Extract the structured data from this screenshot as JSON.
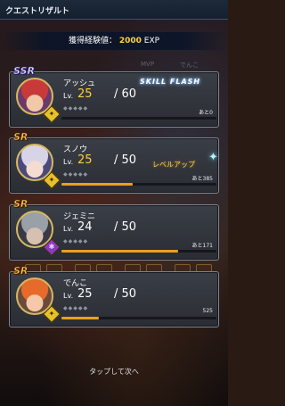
{
  "header": {
    "title": "クエストリザルト"
  },
  "exp_banner": {
    "label": "獲得経験値：",
    "value": "2000",
    "unit": "EXP"
  },
  "background": {
    "col_label_1": "MVP",
    "col_label_2": "でんこ"
  },
  "cards": [
    {
      "rarity": "SSR",
      "name": "アッシュ",
      "lv_label": "Lv.",
      "level": "25",
      "max_level": "/ 60",
      "stars": "◆◆◆◆◆",
      "remain": "あと0",
      "exp_fill": 0,
      "badge": "yellow",
      "badge_glyph": "✦",
      "effect": "SKILL FLASH"
    },
    {
      "rarity": "SR",
      "name": "スノウ",
      "lv_label": "Lv.",
      "level": "25",
      "max_level": "/ 50",
      "stars": "◆◆◆◆◆",
      "remain": "あと385",
      "exp_fill": 0.46,
      "badge": "yellow",
      "badge_glyph": "✦",
      "levelup": "レベルアップ",
      "sparkle": "✦"
    },
    {
      "rarity": "SR",
      "name": "ジェミニ",
      "lv_label": "Lv.",
      "level": "24",
      "max_level": "/ 50",
      "stars": "◆◆◆◆◆",
      "remain": "あと171",
      "exp_fill": 0.75,
      "badge": "purple",
      "badge_glyph": "✱"
    },
    {
      "rarity": "SR",
      "name": "でんこ",
      "lv_label": "Lv.",
      "level": "25",
      "max_level": "/ 50",
      "stars": "◆◆◆◆◆",
      "remain": "525",
      "exp_fill": 0.24,
      "badge": "yellow",
      "badge_glyph": "✦"
    }
  ],
  "footer": {
    "tap_next": "タップして次へ"
  },
  "colors": {
    "accent": "#ffd23c",
    "exp_bar": "#e7a21a",
    "card_border": "#7e8592",
    "header_bg": "#1d2a3a"
  }
}
